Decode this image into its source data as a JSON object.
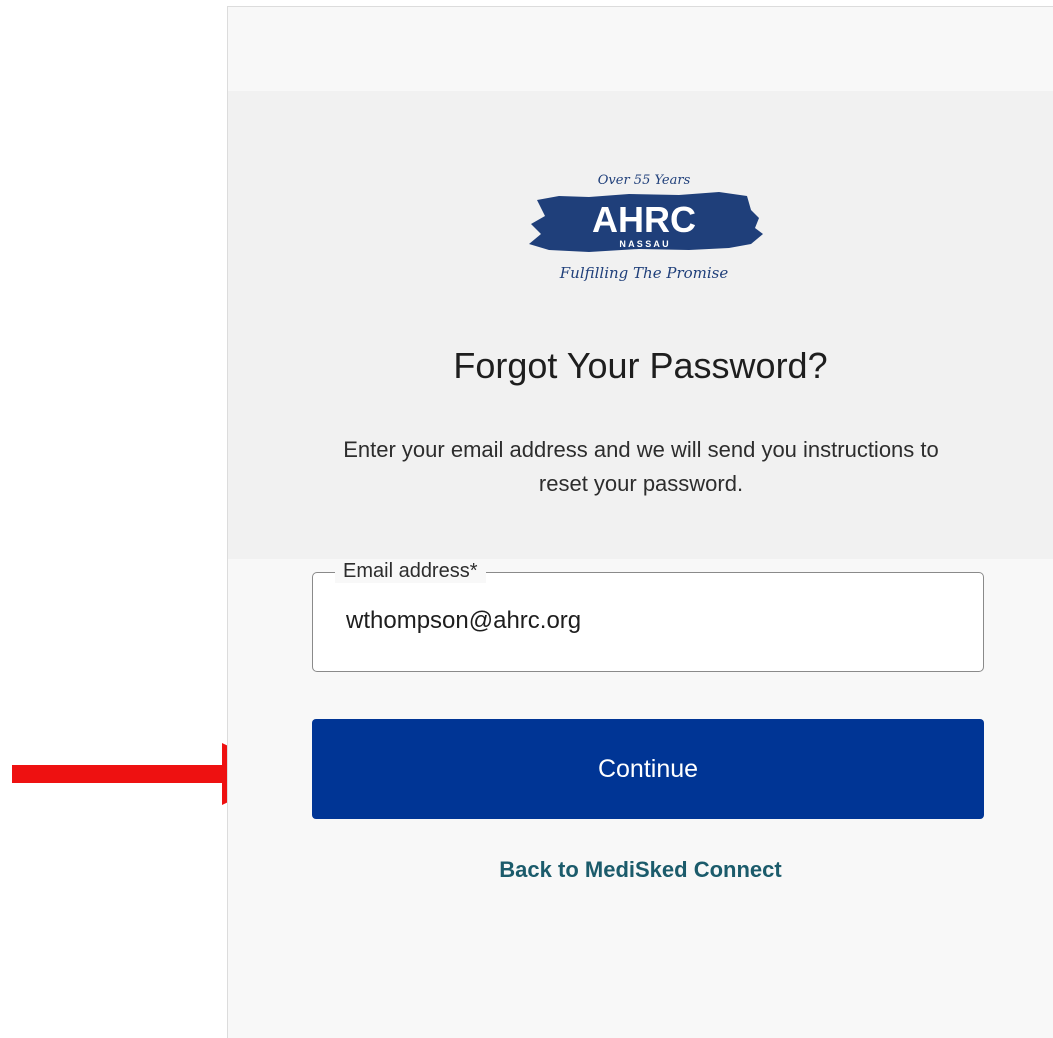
{
  "logo": {
    "tagline_top": "Over 55 Years",
    "brand": "AHRC",
    "region": "N A S S A U",
    "tagline_bottom": "Fulfilling The Promise"
  },
  "form": {
    "title": "Forgot Your Password?",
    "instructions": "Enter your email address and we will send you instructions to reset your password.",
    "email_label": "Email address*",
    "email_value": "wthompson@ahrc.org",
    "continue_label": "Continue",
    "back_link": "Back to MediSked Connect"
  },
  "colors": {
    "primary_button": "#003595",
    "link": "#1b5b6b",
    "logo_blue": "#1f3f7a",
    "annotation_arrow": "#ee1111"
  }
}
